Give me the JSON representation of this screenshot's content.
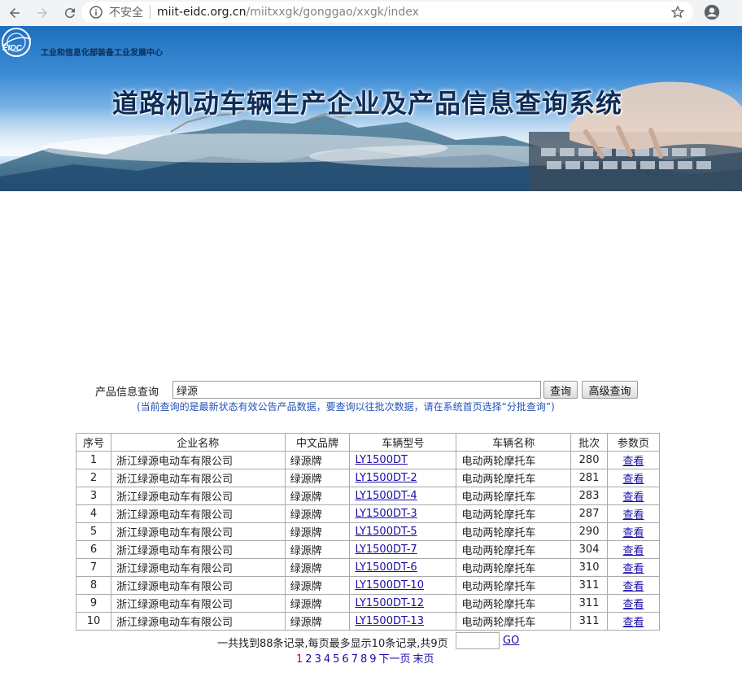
{
  "browser": {
    "insecure_label": "不安全",
    "url_host": "miit-eidc.org.cn",
    "url_path": "/miitxxgk/gonggao/xxgk/index"
  },
  "banner": {
    "logo_text": "EIDC",
    "org_name": "工业和信息化部装备工业发展中心",
    "title": "道路机动车辆生产企业及产品信息查询系统"
  },
  "search": {
    "label": "产品信息查询",
    "value": "绿源",
    "query_button": "查询",
    "advanced_button": "高级查询",
    "hint": "(当前查询的是最新状态有效公告产品数据，要查询以往批次数据，请在系统首页选择“分批查询”)"
  },
  "table": {
    "headers": [
      "序号",
      "企业名称",
      "中文品牌",
      "车辆型号",
      "车辆名称",
      "批次",
      "参数页"
    ],
    "rows": [
      {
        "idx": "1",
        "company": "浙江绿源电动车有限公司",
        "brand": "绿源牌",
        "model": "LY1500DT",
        "vehicle": "电动两轮摩托车",
        "batch": "280",
        "param": "查看"
      },
      {
        "idx": "2",
        "company": "浙江绿源电动车有限公司",
        "brand": "绿源牌",
        "model": "LY1500DT-2",
        "vehicle": "电动两轮摩托车",
        "batch": "281",
        "param": "查看"
      },
      {
        "idx": "3",
        "company": "浙江绿源电动车有限公司",
        "brand": "绿源牌",
        "model": "LY1500DT-4",
        "vehicle": "电动两轮摩托车",
        "batch": "283",
        "param": "查看"
      },
      {
        "idx": "4",
        "company": "浙江绿源电动车有限公司",
        "brand": "绿源牌",
        "model": "LY1500DT-3",
        "vehicle": "电动两轮摩托车",
        "batch": "287",
        "param": "查看"
      },
      {
        "idx": "5",
        "company": "浙江绿源电动车有限公司",
        "brand": "绿源牌",
        "model": "LY1500DT-5",
        "vehicle": "电动两轮摩托车",
        "batch": "290",
        "param": "查看"
      },
      {
        "idx": "6",
        "company": "浙江绿源电动车有限公司",
        "brand": "绿源牌",
        "model": "LY1500DT-7",
        "vehicle": "电动两轮摩托车",
        "batch": "304",
        "param": "查看"
      },
      {
        "idx": "7",
        "company": "浙江绿源电动车有限公司",
        "brand": "绿源牌",
        "model": "LY1500DT-6",
        "vehicle": "电动两轮摩托车",
        "batch": "310",
        "param": "查看"
      },
      {
        "idx": "8",
        "company": "浙江绿源电动车有限公司",
        "brand": "绿源牌",
        "model": "LY1500DT-10",
        "vehicle": "电动两轮摩托车",
        "batch": "311",
        "param": "查看"
      },
      {
        "idx": "9",
        "company": "浙江绿源电动车有限公司",
        "brand": "绿源牌",
        "model": "LY1500DT-12",
        "vehicle": "电动两轮摩托车",
        "batch": "311",
        "param": "查看"
      },
      {
        "idx": "10",
        "company": "浙江绿源电动车有限公司",
        "brand": "绿源牌",
        "model": "LY1500DT-13",
        "vehicle": "电动两轮摩托车",
        "batch": "311",
        "param": "查看"
      }
    ]
  },
  "pager": {
    "summary": "一共找到88条记录,每页最多显示10条记录,共9页",
    "go_label": "GO",
    "pages": [
      "1",
      "2",
      "3",
      "4",
      "5",
      "6",
      "7",
      "8",
      "9"
    ],
    "current_page": "1",
    "next_label": "下一页",
    "last_label": "末页"
  },
  "colors": {
    "hint": "#2452b8",
    "link": "#1a0dab",
    "current_page": "#dd0000"
  }
}
